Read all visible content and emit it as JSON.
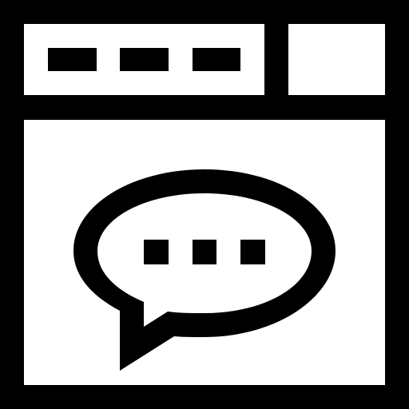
{
  "icon": {
    "name": "browser-chat-window-icon",
    "parts": {
      "window": "browser-window-icon",
      "tab_dots": "tab-dots-icon",
      "side_pane": "side-pane-icon",
      "chat_bubble": "chat-bubble-icon",
      "typing_dots": "typing-dots-icon"
    }
  },
  "colors": {
    "stroke": "#000000",
    "fill": "#ffffff"
  }
}
